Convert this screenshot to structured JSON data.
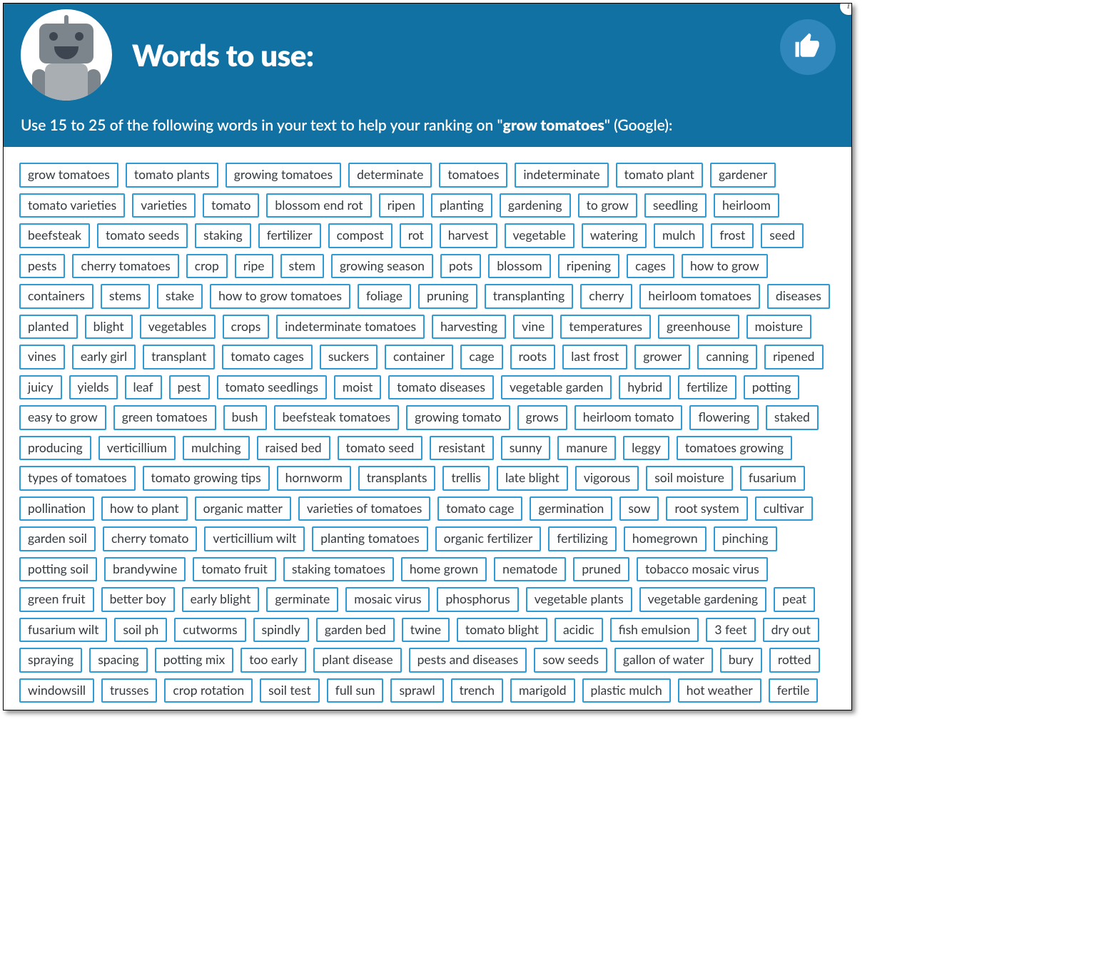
{
  "header": {
    "title": "Words to use:",
    "subhead_prefix": "Use 15 to 25 of the following words in your text to help your ranking on \"",
    "keyword": "grow tomatoes",
    "subhead_suffix": "\" (Google):"
  },
  "words": [
    "grow tomatoes",
    "tomato plants",
    "growing tomatoes",
    "determinate",
    "tomatoes",
    "indeterminate",
    "tomato plant",
    "gardener",
    "tomato varieties",
    "varieties",
    "tomato",
    "blossom end rot",
    "ripen",
    "planting",
    "gardening",
    "to grow",
    "seedling",
    "heirloom",
    "beefsteak",
    "tomato seeds",
    "staking",
    "fertilizer",
    "compost",
    "rot",
    "harvest",
    "vegetable",
    "watering",
    "mulch",
    "frost",
    "seed",
    "pests",
    "cherry tomatoes",
    "crop",
    "ripe",
    "stem",
    "growing season",
    "pots",
    "blossom",
    "ripening",
    "cages",
    "how to grow",
    "containers",
    "stems",
    "stake",
    "how to grow tomatoes",
    "foliage",
    "pruning",
    "transplanting",
    "cherry",
    "heirloom tomatoes",
    "diseases",
    "planted",
    "blight",
    "vegetables",
    "crops",
    "indeterminate tomatoes",
    "harvesting",
    "vine",
    "temperatures",
    "greenhouse",
    "moisture",
    "vines",
    "early girl",
    "transplant",
    "tomato cages",
    "suckers",
    "container",
    "cage",
    "roots",
    "last frost",
    "grower",
    "canning",
    "ripened",
    "juicy",
    "yields",
    "leaf",
    "pest",
    "tomato seedlings",
    "moist",
    "tomato diseases",
    "vegetable garden",
    "hybrid",
    "fertilize",
    "potting",
    "easy to grow",
    "green tomatoes",
    "bush",
    "beefsteak tomatoes",
    "growing tomato",
    "grows",
    "heirloom tomato",
    "flowering",
    "staked",
    "producing",
    "verticillium",
    "mulching",
    "raised bed",
    "tomato seed",
    "resistant",
    "sunny",
    "manure",
    "leggy",
    "tomatoes growing",
    "types of tomatoes",
    "tomato growing tips",
    "hornworm",
    "transplants",
    "trellis",
    "late blight",
    "vigorous",
    "soil moisture",
    "fusarium",
    "pollination",
    "how to plant",
    "organic matter",
    "varieties of tomatoes",
    "tomato cage",
    "germination",
    "sow",
    "root system",
    "cultivar",
    "garden soil",
    "cherry tomato",
    "verticillium wilt",
    "planting tomatoes",
    "organic fertilizer",
    "fertilizing",
    "homegrown",
    "pinching",
    "potting soil",
    "brandywine",
    "tomato fruit",
    "staking tomatoes",
    "home grown",
    "nematode",
    "pruned",
    "tobacco mosaic virus",
    "green fruit",
    "better boy",
    "early blight",
    "germinate",
    "mosaic virus",
    "phosphorus",
    "vegetable plants",
    "vegetable gardening",
    "peat",
    "fusarium wilt",
    "soil ph",
    "cutworms",
    "spindly",
    "garden bed",
    "twine",
    "tomato blight",
    "acidic",
    "fish emulsion",
    "3 feet",
    "dry out",
    "spraying",
    "spacing",
    "potting mix",
    "too early",
    "plant disease",
    "pests and diseases",
    "sow seeds",
    "gallon of water",
    "bury",
    "rotted",
    "windowsill",
    "trusses",
    "crop rotation",
    "soil test",
    "full sun",
    "sprawl",
    "trench",
    "marigold",
    "plastic mulch",
    "hot weather",
    "fertile"
  ]
}
